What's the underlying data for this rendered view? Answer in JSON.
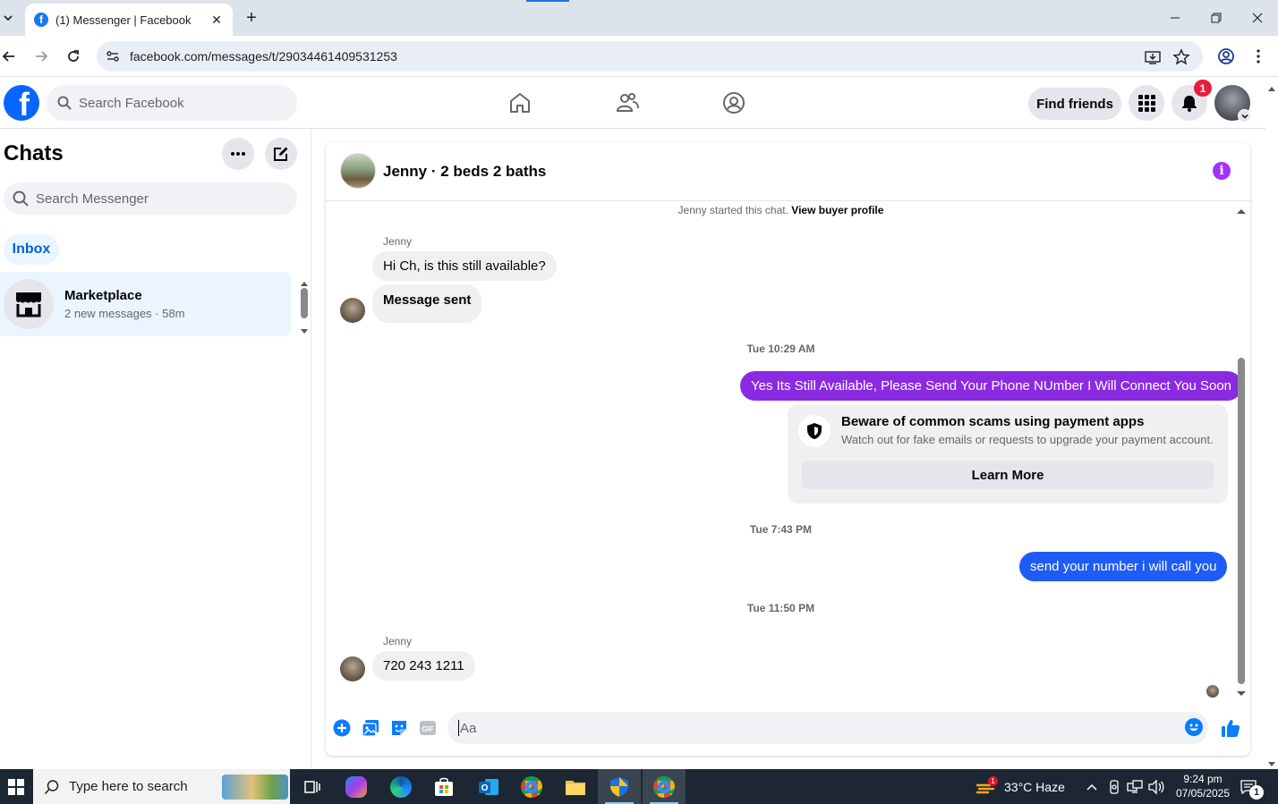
{
  "browser": {
    "tab_title": "(1) Messenger | Facebook",
    "url": "facebook.com/messages/t/29034461409531253"
  },
  "facebook": {
    "search_placeholder": "Search Facebook",
    "find_friends": "Find friends",
    "notification_count": "1"
  },
  "chats": {
    "title": "Chats",
    "search_placeholder": "Search Messenger",
    "inbox_label": "Inbox",
    "conversations": [
      {
        "name": "Marketplace",
        "preview": "2 new messages · 58m"
      }
    ]
  },
  "conversation": {
    "title": "Jenny · 2 beds 2 baths",
    "started_text": "Jenny started this chat.",
    "buyer_profile_link": "View buyer profile",
    "messages": [
      {
        "sender": "Jenny",
        "text": "Hi Ch, is this still available?"
      },
      {
        "text": "Message sent"
      },
      {
        "timestamp": "Tue 10:29 AM"
      },
      {
        "text": "Yes Its Still Available, Please Send Your Phone NUmber I Will Connect You Soon"
      },
      {
        "timestamp": "Tue 7:43 PM"
      },
      {
        "text": "send your number i will call you"
      },
      {
        "timestamp": "Tue 11:50 PM"
      },
      {
        "sender": "Jenny",
        "text": "720 243 1211"
      }
    ],
    "scam_card": {
      "title": "Beware of common scams using payment apps",
      "body": "Watch out for fake emails or requests to upgrade your payment account.",
      "button": "Learn More"
    },
    "composer_placeholder": "Aa",
    "colors": {
      "outgoing_purple": "#8a2be2",
      "outgoing_blue": "#1f5cf5",
      "accent": "#0a7cff"
    }
  },
  "taskbar": {
    "search_placeholder": "Type here to search",
    "weather": "33°C  Haze",
    "time": "9:24 pm",
    "date": "07/05/2025",
    "notification_count": "1",
    "weather_alert_count": "1"
  }
}
